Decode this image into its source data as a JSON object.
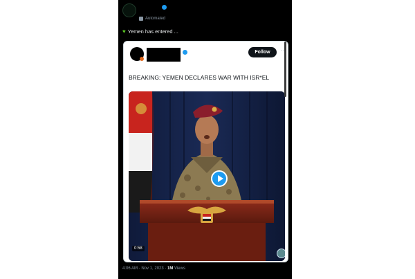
{
  "post": {
    "badge": "Automated",
    "text": "Yemen has entered ...",
    "footer_time": "4:06 AM · Nov 1, 2023 · ",
    "footer_views_count": "1M",
    "footer_views_label": " Views"
  },
  "quoted": {
    "follow_label": "Follow",
    "more_label": "···",
    "headline": "BREAKING: YEMEN DECLARES WAR WITH ISR*EL",
    "video_duration": "0:58"
  },
  "icons": {
    "heart": "green-heart-icon",
    "automated": "bot-icon",
    "verified": "verified-badge-icon",
    "play": "play-icon"
  },
  "colors": {
    "background": "#000000",
    "accent": "#1d9bf0",
    "heart": "#58c322"
  }
}
